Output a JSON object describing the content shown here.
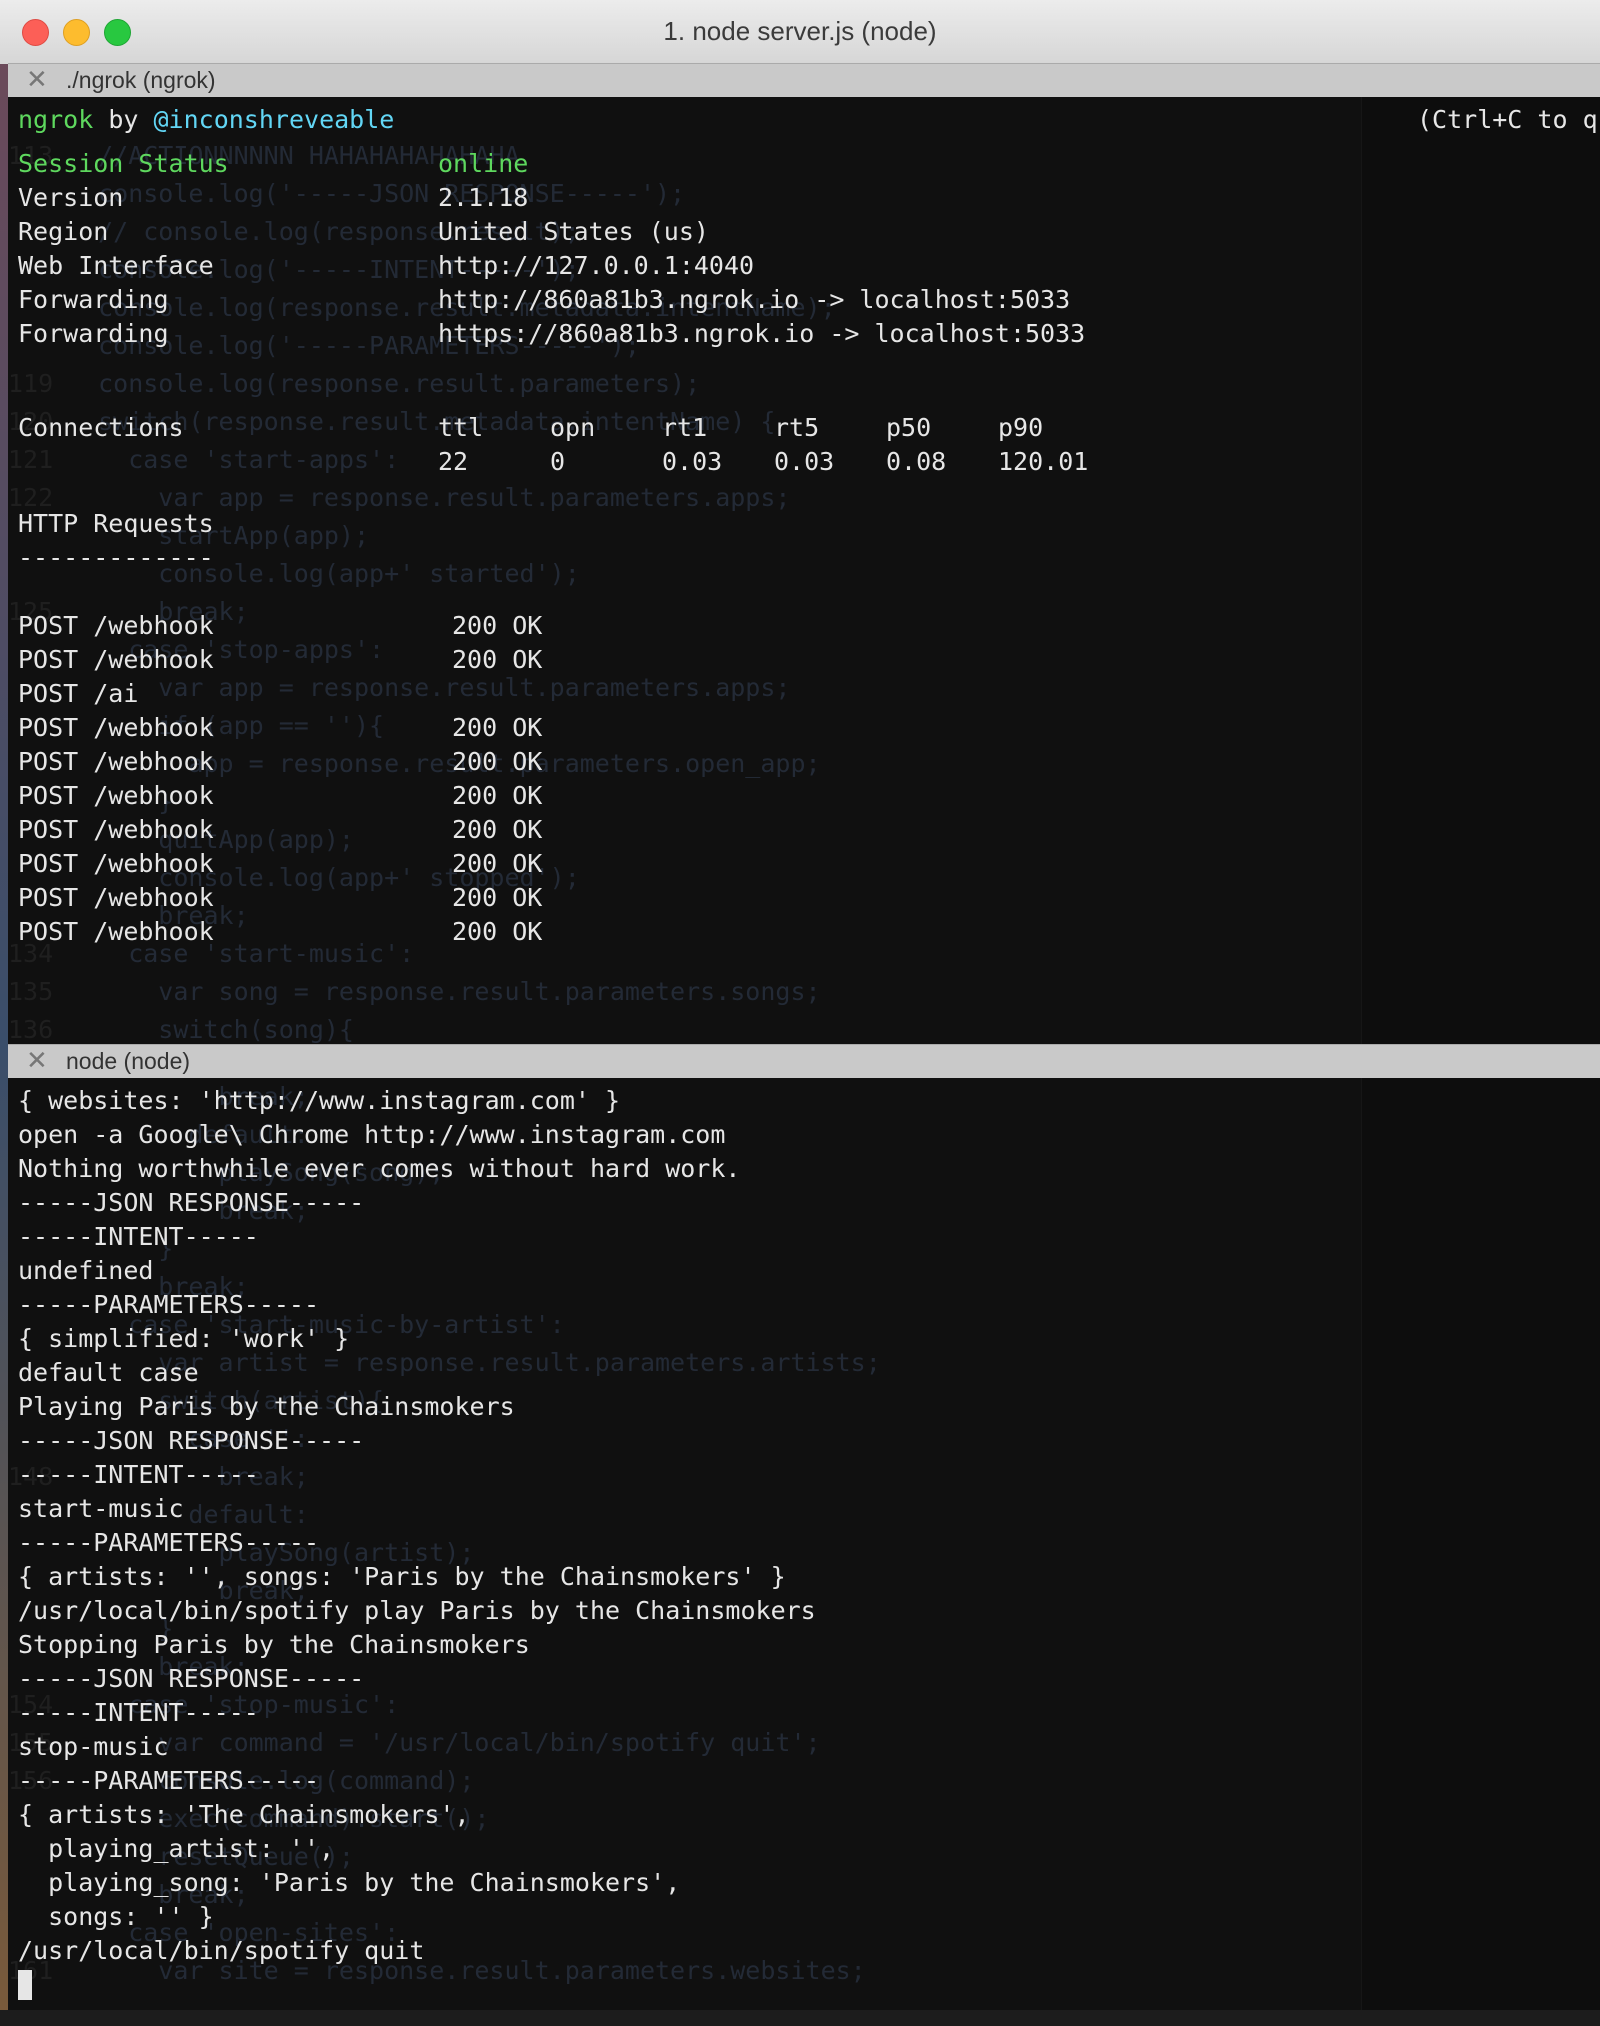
{
  "window": {
    "title": "1. node server.js (node)"
  },
  "pane_top": {
    "tab_title": "./ngrok (ngrok)",
    "brand": "ngrok",
    "by": "by",
    "author": "@inconshreveable",
    "quit_hint": "(Ctrl+C to qu",
    "session": [
      {
        "key": "Session Status",
        "value": "online"
      },
      {
        "key": "Version",
        "value": "2.1.18"
      },
      {
        "key": "Region",
        "value": "United States (us)"
      },
      {
        "key": "Web Interface",
        "value": "http://127.0.0.1:4040"
      },
      {
        "key": "Forwarding",
        "value": "http://860a81b3.ngrok.io -> localhost:5033"
      },
      {
        "key": "Forwarding",
        "value": "https://860a81b3.ngrok.io -> localhost:5033"
      }
    ],
    "connections_label": "Connections",
    "connections_headers": [
      "ttl",
      "opn",
      "rt1",
      "rt5",
      "p50",
      "p90"
    ],
    "connections_values": [
      "22",
      "0",
      "0.03",
      "0.03",
      "0.08",
      "120.01"
    ],
    "http_requests_label": "HTTP Requests",
    "http_requests_rule": "-------------",
    "requests": [
      {
        "req": "POST /webhook",
        "status": "200 OK"
      },
      {
        "req": "POST /webhook",
        "status": "200 OK"
      },
      {
        "req": "POST /ai",
        "status": ""
      },
      {
        "req": "POST /webhook",
        "status": "200 OK"
      },
      {
        "req": "POST /webhook",
        "status": "200 OK"
      },
      {
        "req": "POST /webhook",
        "status": "200 OK"
      },
      {
        "req": "POST /webhook",
        "status": "200 OK"
      },
      {
        "req": "POST /webhook",
        "status": "200 OK"
      },
      {
        "req": "POST /webhook",
        "status": "200 OK"
      },
      {
        "req": "POST /webhook",
        "status": "200 OK"
      }
    ],
    "ghost_lines": [
      {
        "num": "113",
        "code": "  //ACTIONNNNNN HAHAHAHAHAHAHA"
      },
      {
        "num": "",
        "code": "  console.log('-----JSON RESPONSE-----');"
      },
      {
        "num": "",
        "code": "  // console.log(response.result);"
      },
      {
        "num": "",
        "code": "  console.log('-----INTENT-----');"
      },
      {
        "num": "",
        "code": "  console.log(response.result.metadata.intentName);"
      },
      {
        "num": "",
        "code": "  console.log('-----PARAMETERS-----');"
      },
      {
        "num": "119",
        "code": "  console.log(response.result.parameters);"
      },
      {
        "num": "120",
        "code": "  switch(response.result.metadata.intentName) {"
      },
      {
        "num": "121",
        "code": "    case 'start-apps':"
      },
      {
        "num": "122",
        "code": "      var app = response.result.parameters.apps;"
      },
      {
        "num": "",
        "code": "      startApp(app);"
      },
      {
        "num": "",
        "code": "      console.log(app+' started');"
      },
      {
        "num": "125",
        "code": "      break;"
      },
      {
        "num": "",
        "code": "    case 'stop-apps':"
      },
      {
        "num": "",
        "code": "      var app = response.result.parameters.apps;"
      },
      {
        "num": "",
        "code": "      if (app == ''){"
      },
      {
        "num": "",
        "code": "        app = response.result.parameters.open_app;"
      },
      {
        "num": "",
        "code": "      }"
      },
      {
        "num": "",
        "code": "      quitApp(app);"
      },
      {
        "num": "",
        "code": "      console.log(app+' stopped');"
      },
      {
        "num": "",
        "code": "      break;"
      },
      {
        "num": "134",
        "code": "    case 'start-music':"
      },
      {
        "num": "135",
        "code": "      var song = response.result.parameters.songs;"
      },
      {
        "num": "136",
        "code": "      switch(song){"
      }
    ]
  },
  "pane_bottom": {
    "tab_title": "node (node)",
    "lines": [
      "{ websites: 'http://www.instagram.com' }",
      "open -a Google\\ Chrome http://www.instagram.com",
      "Nothing worthwhile ever comes without hard work.",
      "-----JSON RESPONSE-----",
      "-----INTENT-----",
      "undefined",
      "-----PARAMETERS-----",
      "{ simplified: 'work' }",
      "default case",
      "Playing Paris by the Chainsmokers",
      "-----JSON RESPONSE-----",
      "-----INTENT-----",
      "start-music",
      "-----PARAMETERS-----",
      "{ artists: '', songs: 'Paris by the Chainsmokers' }",
      "/usr/local/bin/spotify play Paris by the Chainsmokers",
      "Stopping Paris by the Chainsmokers",
      "-----JSON RESPONSE-----",
      "-----INTENT-----",
      "stop-music",
      "-----PARAMETERS-----",
      "{ artists: 'The Chainsmokers',",
      "  playing_artist: '',",
      "  playing_song: 'Paris by the Chainsmokers',",
      "  songs: '' }",
      "/usr/local/bin/spotify quit"
    ],
    "ghost_lines": [
      {
        "num": "",
        "code": "          break;"
      },
      {
        "num": "",
        "code": "        default:"
      },
      {
        "num": "",
        "code": "          playSong(song);"
      },
      {
        "num": "",
        "code": "          break;"
      },
      {
        "num": "",
        "code": "      }"
      },
      {
        "num": "",
        "code": "      break;"
      },
      {
        "num": "",
        "code": "    case 'start-music-by-artist':"
      },
      {
        "num": "",
        "code": "      var artist = response.result.parameters.artists;"
      },
      {
        "num": "",
        "code": "      switch(artist){"
      },
      {
        "num": "",
        "code": "        case '':"
      },
      {
        "num": "148",
        "code": "          break;"
      },
      {
        "num": "",
        "code": "        default:"
      },
      {
        "num": "",
        "code": "          playSong(artist);"
      },
      {
        "num": "",
        "code": "          break;"
      },
      {
        "num": "",
        "code": "      }"
      },
      {
        "num": "",
        "code": "      break;"
      },
      {
        "num": "154",
        "code": "    case 'stop-music':"
      },
      {
        "num": "155",
        "code": "      var command = '/usr/local/bin/spotify quit';"
      },
      {
        "num": "156",
        "code": "      console.log(command);"
      },
      {
        "num": "",
        "code": "      exec(command).start();"
      },
      {
        "num": "",
        "code": "      resetQueue();"
      },
      {
        "num": "",
        "code": "      break;"
      },
      {
        "num": "",
        "code": "    case 'open-sites':"
      },
      {
        "num": "161",
        "code": "      var site = response.result.parameters.websites;"
      }
    ]
  },
  "colors": {
    "green": "#5ed85e",
    "cyan": "#62d6f5",
    "text": "#e6e6e6",
    "background": "#101010"
  }
}
